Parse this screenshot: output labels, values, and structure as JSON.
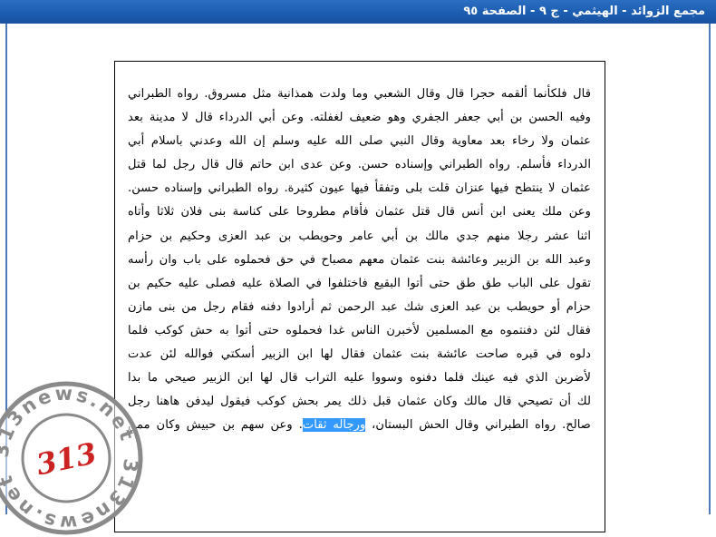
{
  "window": {
    "title": "مجمع الزوائد - الهيثمي - ج ٩ - الصفحة ٩٥"
  },
  "document": {
    "lines": [
      "قال فلكأنما ألقمه حجرا قال وقال الشعبي وما ولدت همذانية مثل مسروق. رواه الطبراني",
      "وفيه الحسن بن أبي جعفر الجفري وهو ضعيف لغفلته. وعن أبي الدرداء قال لا مدينة بعد",
      "عثمان ولا رخاء بعد معاوية وقال النبي صلى الله عليه وسلم إن الله وعدني باسلام أبي",
      "الدرداء فأسلم. رواه الطبراني وإسناده حسن. وعن عدى ابن حاتم قال قال رجل لما قتل",
      "عثمان لا ينتطح فيها عنزان قلت بلى وتفقأ فيها عيون كثيرة. رواه الطبراني وإسناده حسن.",
      "وعن ملك يعنى ابن أنس قال قتل عثمان فأقام مطروحا على كناسة بنى فلان ثلاثا وأتاه",
      "اثنا عشر رجلا منهم جدي مالك بن أبي عامر وحويطب بن عبد العزى وحكيم بن حزام",
      "وعبد الله بن الزبير وعائشة بنت عثمان معهم مصباح في حق فحملوه على باب وان رأسه",
      "تقول على الباب طق طق حتى أتوا البقيع فاختلفوا في الصلاة عليه فصلى عليه حكيم بن",
      "حزام أو حويطب بن عبد العزى شك عبد الرحمن ثم أرادوا دفنه فقام رجل من بنى مازن",
      "فقال لئن دفنتموه مع المسلمين لأخبرن الناس غدا فحملوه حتى أتوا به حش كوكب فلما",
      "دلوه في قبره صاحت عائشة بنت عثمان فقال لها ابن الزبير أسكتي فوالله لئن عدت",
      "لأضربن الذي فيه عينك فلما دفنوه وسووا عليه التراب قال لها ابن الزبير صيحي ما بدا",
      "لك أن تصيحي قال مالك وكان عثمان قبل ذلك يمر بحش كوكب فيقول ليدفن هاهنا رجل"
    ],
    "last_line_before": "صالح. رواه الطبراني وقال الحش البستان، ",
    "last_line_highlight": "ورجاله ثقات",
    "last_line_after": ". وعن سهم بن حبيش وكان ممن"
  },
  "watermark": {
    "number": "313",
    "text": "313news.net"
  },
  "colors": {
    "title_bar": "#1d5db0",
    "highlight": "#3399ff",
    "stamp": "#8a8a8a",
    "stamp_number": "#cc2222"
  }
}
